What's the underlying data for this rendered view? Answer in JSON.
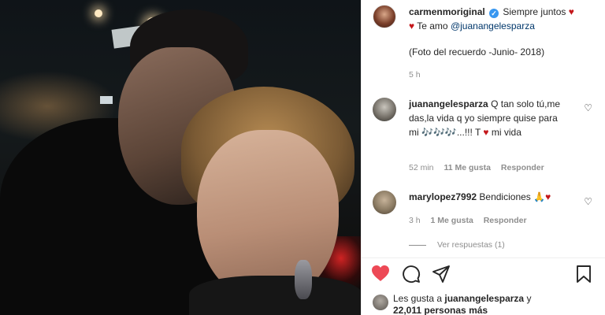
{
  "post": {
    "author": "carmenmoriginal",
    "caption_start": "Siempre juntos",
    "caption_line2": "Te amo",
    "mention": "@juanangelesparza",
    "caption_line3": "(Foto del recuerdo -Junio- 2018)",
    "time": "5 h"
  },
  "comments": [
    {
      "user": "juanangelesparza",
      "text_part1": "Q tan solo tú,me das,la vida q yo siempre quise para mi",
      "notes": "🎶🎶🎶",
      "text_part2": "...!!! T",
      "text_part3": "mi vida",
      "time": "52 min",
      "likes": "11 Me gusta",
      "reply": "Responder"
    },
    {
      "user": "marylopez7992",
      "text": "Bendiciones",
      "emoji": "🙏",
      "time": "3 h",
      "likes": "1 Me gusta",
      "reply": "Responder",
      "view_replies": "Ver respuestas (1)"
    }
  ],
  "likes_summary": {
    "prefix": "Les gusta a",
    "user": "juanangelesparza",
    "suffix": "y",
    "count_text": "22,011 personas más"
  },
  "icons": [
    "verified-icon",
    "heart-icon",
    "comment-icon",
    "share-icon",
    "bookmark-icon"
  ],
  "colors": {
    "liked_heart": "#ed4956",
    "verified": "#3897f0",
    "link": "#00376b",
    "muted": "#8e8e8e"
  }
}
